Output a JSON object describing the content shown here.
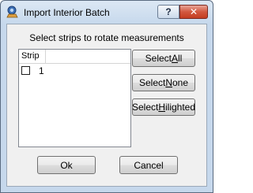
{
  "window": {
    "title": "Import Interior Batch",
    "help_button": "?",
    "close_button": "✕"
  },
  "instruction": "Select strips to rotate measurements",
  "list": {
    "columns": [
      "Strip",
      ""
    ],
    "rows": [
      {
        "checked": false,
        "label": "1"
      }
    ]
  },
  "buttons": {
    "select_all": {
      "prefix": "Select ",
      "mnemonic": "A",
      "suffix": "ll"
    },
    "select_none": {
      "prefix": "Select ",
      "mnemonic": "N",
      "suffix": "one"
    },
    "select_hilighted": {
      "prefix": "Select ",
      "mnemonic": "H",
      "suffix": "ilighted"
    },
    "ok": "Ok",
    "cancel": "Cancel"
  },
  "icons": {
    "app": "app-icon",
    "help": "help-icon",
    "close": "close-icon",
    "checkbox": "checkbox-unchecked-icon"
  }
}
